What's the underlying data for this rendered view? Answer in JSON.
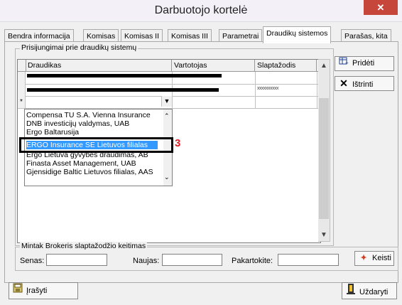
{
  "window": {
    "title": "Darbuotojo kortelė",
    "close_glyph": "✕"
  },
  "tabs": [
    {
      "label": "Bendra informacija"
    },
    {
      "label": "Komisas"
    },
    {
      "label": "Komisas II"
    },
    {
      "label": "Komisas III"
    },
    {
      "label": "Parametrai"
    },
    {
      "label": "Draudikų sistemos"
    },
    {
      "label": "Parašas, kita"
    }
  ],
  "connections_group": {
    "label": "Prisijungimai prie draudikų sistemų",
    "columns": [
      "Draudikas",
      "Vartotojas",
      "Slaptažodis"
    ],
    "rows": [
      {
        "draudikas": "",
        "vartotojas": "",
        "slaptazodis": ""
      },
      {
        "draudikas": "",
        "vartotojas": "",
        "slaptazodis": "xxxxxxxxxx"
      }
    ],
    "new_row_marker": "*",
    "combo_arrow": "▼"
  },
  "dropdown": {
    "items": [
      "Compensa TU S.A. Vienna Insurance",
      "DNB investicijų valdymas, UAB",
      "Ergo Baltarusija",
      "ERGO Insurance SE Lietuvos filialas",
      "Ergo Lietuva gyvybės draudimas, AB",
      "Finasta Asset Management, UAB",
      "Gjensidige Baltic Lietuvos filialas, AAS"
    ],
    "selected": "ERGO Insurance SE Lietuvos filialas"
  },
  "annotation": {
    "number": "3",
    "color": "#e21b23"
  },
  "buttons": {
    "add": "Pridėti",
    "delete": "Ištrinti",
    "change": "Keisti",
    "save": "Įrašyti",
    "close": "Uždaryti"
  },
  "password_group": {
    "label": "Mintak Brokeris slaptažodžio keitimas",
    "old_label": "Senas:",
    "new_label": "Naujas:",
    "repeat_label": "Pakartokite:",
    "old_value": "",
    "new_value": "",
    "repeat_value": ""
  },
  "icons": {
    "add": "table-add-icon",
    "delete": "x-icon",
    "change": "key-change-icon",
    "save": "save-icon",
    "close": "exit-door-icon"
  },
  "colors": {
    "selection": "#3399ff",
    "close_button": "#c7463c",
    "annotation": "#e21b23"
  }
}
